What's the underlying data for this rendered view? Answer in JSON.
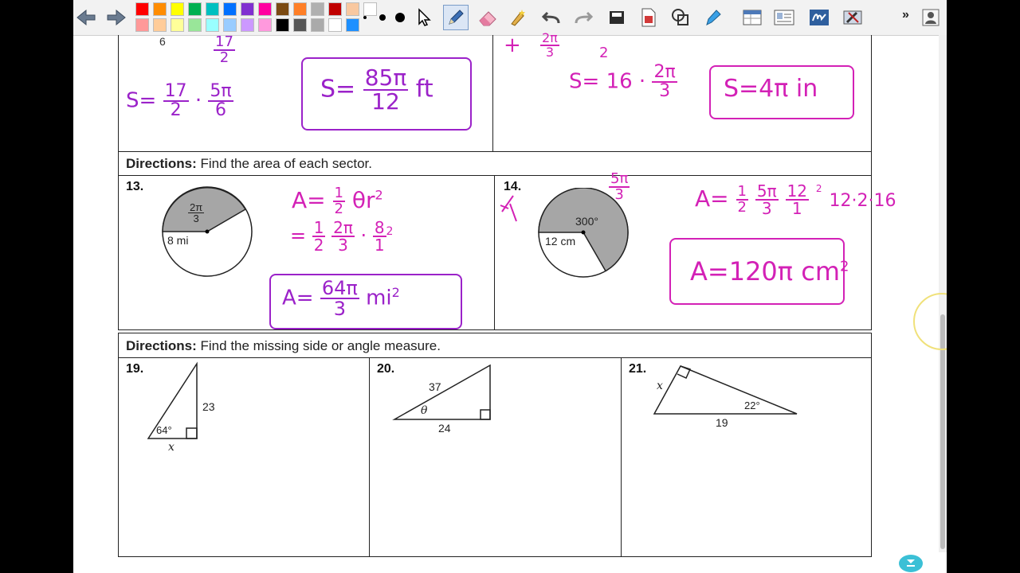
{
  "toolbar": {
    "colors_top": [
      "#ff0000",
      "#ff8c00",
      "#ffff00",
      "#00b050",
      "#00c0c0",
      "#0070ff",
      "#8030d0",
      "#ff00a0",
      "#7b4a12",
      "#ff7f27",
      "#b0b0b0",
      "#c00000",
      "#f9c8a0",
      "#ffffff"
    ],
    "colors_bottom": [
      "#ff9999",
      "#ffcc99",
      "#ffff99",
      "#99e699",
      "#99ffff",
      "#99ccff",
      "#cc99ff",
      "#ff99dd",
      "#000000",
      "#555555",
      "#aaaaaa",
      "#ffffff",
      "#1e90ff"
    ],
    "overflow_label": "»"
  },
  "top_left": {
    "partial_6": "6",
    "frac_top_num": "17",
    "frac_top_den": "2",
    "s_label": "S=",
    "f1_num": "17",
    "f1_den": "2",
    "dot": "·",
    "f2_num": "5π",
    "f2_den": "6",
    "ans_prefix": "S=",
    "ans_num": "85π",
    "ans_den": "12",
    "ans_unit": "ft"
  },
  "top_right": {
    "partial_mark": "+",
    "partial_num": "2π",
    "partial_den": "3",
    "partial_2": "2",
    "s_label": "S=",
    "val": "16",
    "dot": "·",
    "f_num": "2π",
    "f_den": "3",
    "answer": "S=4π in"
  },
  "section1": {
    "directions_label": "Directions:",
    "directions_text": " Find the area of each sector."
  },
  "p13": {
    "number": "13.",
    "angle_num": "2π",
    "angle_den": "3",
    "radius": "8 mi",
    "formula_a": "A=",
    "half_num": "1",
    "half_den": "2",
    "formula_rest": "θr",
    "sq": "2",
    "eq": "=",
    "s2_half_num": "1",
    "s2_half_den": "2",
    "s2_f_num": "2π",
    "s2_f_den": "3",
    "s2_dot": "·",
    "s2_r_num": "8",
    "s2_r_den": "1",
    "s2_sq": "2",
    "ans_prefix": "A=",
    "ans_num": "64π",
    "ans_den": "3",
    "ans_unit": "mi",
    "ans_sq": "2"
  },
  "p14": {
    "number": "14.",
    "side_note_num": "5π",
    "side_note_den": "3",
    "angle": "300°",
    "radius": "12 cm",
    "formula_a": "A=",
    "half_num": "1",
    "half_den": "2",
    "f_num": "5π",
    "f_den": "3",
    "r_num": "12",
    "r_den": "1",
    "r_small": "2",
    "tail": "12·2·16",
    "answer": "A=120π cm",
    "ans_sq": "2"
  },
  "section2": {
    "directions_label": "Directions:",
    "directions_text": " Find the missing side or angle measure."
  },
  "p19": {
    "number": "19.",
    "side": "23",
    "angle": "64°",
    "unknown": "x"
  },
  "p20": {
    "number": "20.",
    "hyp": "37",
    "base": "24",
    "angle": "θ"
  },
  "p21": {
    "number": "21.",
    "unknown": "x",
    "angle": "22°",
    "base": "19"
  }
}
